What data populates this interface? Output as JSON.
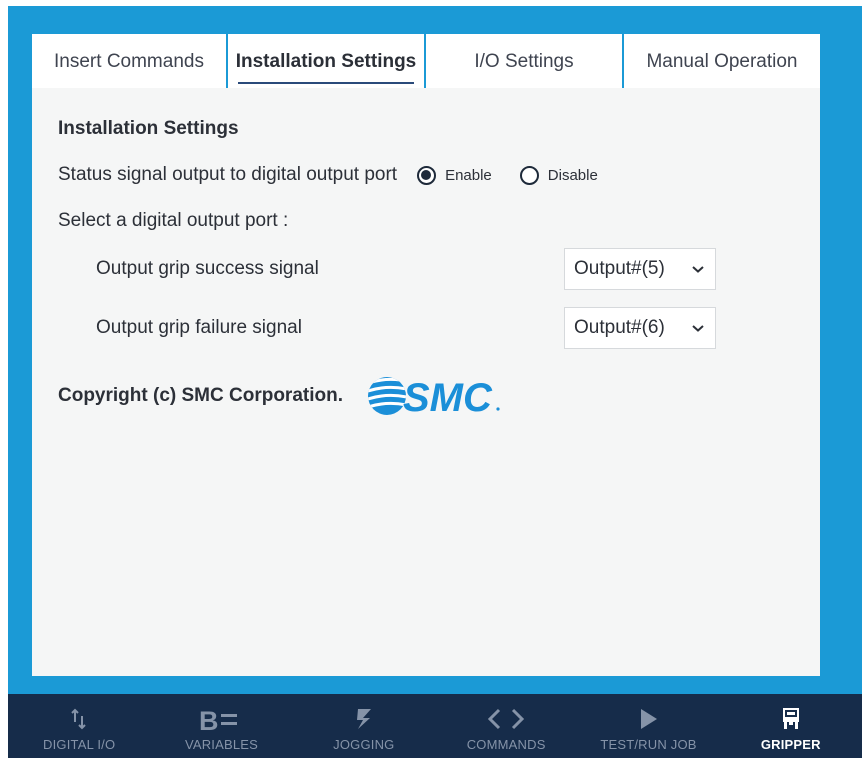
{
  "tabs": [
    {
      "label": "Insert Commands",
      "active": false
    },
    {
      "label": "Installation Settings",
      "active": true
    },
    {
      "label": "I/O Settings",
      "active": false
    },
    {
      "label": "Manual Operation",
      "active": false
    }
  ],
  "panel": {
    "title": "Installation Settings",
    "status_label": "Status signal output to digital output port",
    "radio_enable": "Enable",
    "radio_disable": "Disable",
    "radio_selected": "Enable",
    "select_port_label": "Select a digital output port :",
    "outputs": [
      {
        "label": "Output grip success signal",
        "value": "Output#(5)"
      },
      {
        "label": "Output grip failure signal",
        "value": "Output#(6)"
      }
    ],
    "copyright": "Copyright (c) SMC Corporation.",
    "logo_text": "SMC"
  },
  "bottom_nav": [
    {
      "label": "DIGITAL I/O",
      "icon": "digital-io-icon",
      "active": false
    },
    {
      "label": "VARIABLES",
      "icon": "variables-icon",
      "active": false
    },
    {
      "label": "JOGGING",
      "icon": "jogging-icon",
      "active": false
    },
    {
      "label": "COMMANDS",
      "icon": "commands-icon",
      "active": false
    },
    {
      "label": "TEST/RUN JOB",
      "icon": "play-icon",
      "active": false
    },
    {
      "label": "GRIPPER",
      "icon": "gripper-icon",
      "active": true
    }
  ],
  "colors": {
    "frame": "#1b9ad6",
    "panel": "#f5f6f6",
    "nav_bar": "#162c4a",
    "logo": "#1b8fd8"
  }
}
